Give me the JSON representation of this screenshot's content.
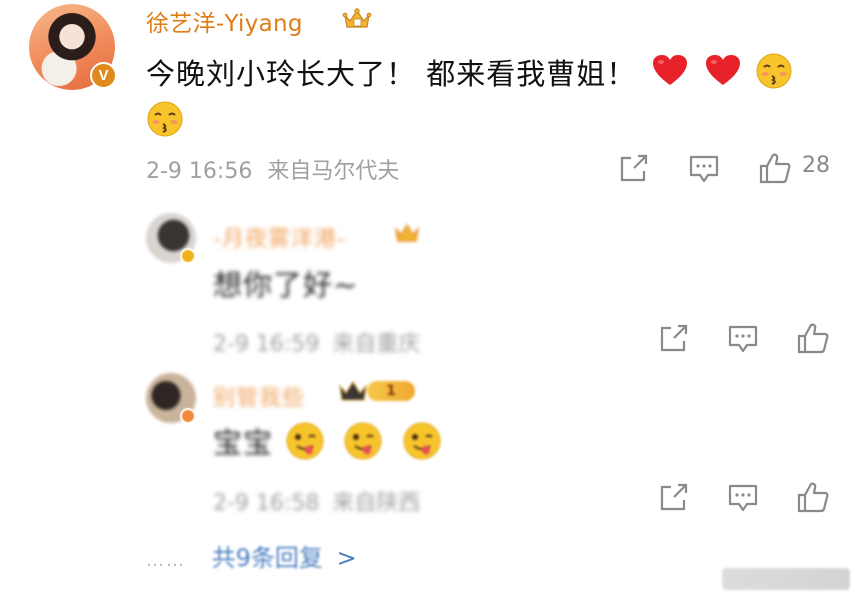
{
  "post": {
    "author": "徐艺洋-Yiyang",
    "verified_badge": "V",
    "text_line1": "今晚刘小玲长大了！ 都来看我曹姐！",
    "emojis": [
      "heart-icon",
      "heart-icon",
      "kiss-emoji",
      "kiss-emoji"
    ],
    "timestamp": "2-9 16:56",
    "source": "来自马尔代夫",
    "like_count": "28"
  },
  "replies": [
    {
      "name": "-月夜雾洋港-",
      "text": "想你了好~",
      "timestamp": "2-9 16:59",
      "source": "来自重庆"
    },
    {
      "name": "别管我些",
      "level": "1",
      "text": "宝宝",
      "timestamp": "2-9 16:58",
      "source": "来自陕西"
    }
  ],
  "more": {
    "dots": "……",
    "label": "共9条回复",
    "arrow": ">"
  },
  "colors": {
    "author": "#e07c18",
    "meta": "#a0a0a0",
    "link": "#4a7fc1",
    "heart": "#e8222a"
  }
}
